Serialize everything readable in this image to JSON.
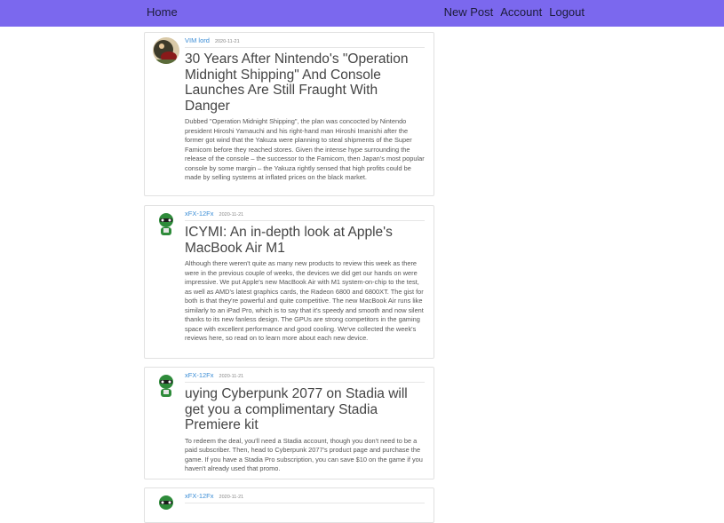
{
  "nav": {
    "home": "Home",
    "new_post": "New Post",
    "account": "Account",
    "logout": "Logout"
  },
  "colors": {
    "navbar": "#7b68ee",
    "author_link": "#3b8dd6"
  },
  "posts": [
    {
      "author": "VIM lord",
      "date": "2020-11-21",
      "avatar": "vim-lord-avatar",
      "title": "30 Years After Nintendo's \"Operation Midnight Shipping\" And Console Launches Are Still Fraught With Danger",
      "summary": "Dubbed \"Operation Midnight Shipping\", the plan was concocted by Nintendo president Hiroshi Yamauchi and his right-hand man Hiroshi Imanishi after the former got wind that the Yakuza were planning to steal shipments of the Super Famicom before they reached stores. Given the intense hype surrounding the release of the console – the successor to the Famicom, then Japan's most popular console by some margin – the Yakuza rightly sensed that high profits could be made by selling systems at inflated prices on the black market."
    },
    {
      "author": "xFX-12Fx",
      "date": "2020-11-21",
      "avatar": "xfx-avatar",
      "title": "ICYMI: An in-depth look at Apple's MacBook Air M1",
      "summary": "Although there weren't quite as many new products to review this week as there were in the previous couple of weeks, the devices we did get our hands on were impressive. We put Apple's new MacBook Air with M1 system-on-chip to the test, as well as AMD's latest graphics cards, the Radeon 6800 and 6800XT. The gist for both is that they're powerful and quite competitive. The new MacBook Air runs like similarly to an iPad Pro, which is to say that it's speedy and smooth and now silent thanks to its new fanless design. The GPUs are strong competitors in the gaming space with excellent performance and good cooling. We've collected the week's reviews here, so read on to learn more about each new device."
    },
    {
      "author": "xFX-12Fx",
      "date": "2020-11-21",
      "avatar": "xfx-avatar",
      "title": "uying Cyberpunk 2077 on Stadia will get you a complimentary Stadia Premiere kit",
      "summary": "To redeem the deal, you'll need a Stadia account, though you don't need to be a paid subscriber. Then, head to Cyberpunk 2077's product page and purchase the game. If you have a Stadia Pro subscription, you can save $10 on the game if you haven't already used that promo."
    },
    {
      "author": "xFX-12Fx",
      "date": "2020-11-21",
      "avatar": "xfx-avatar",
      "title": "",
      "summary": ""
    }
  ]
}
